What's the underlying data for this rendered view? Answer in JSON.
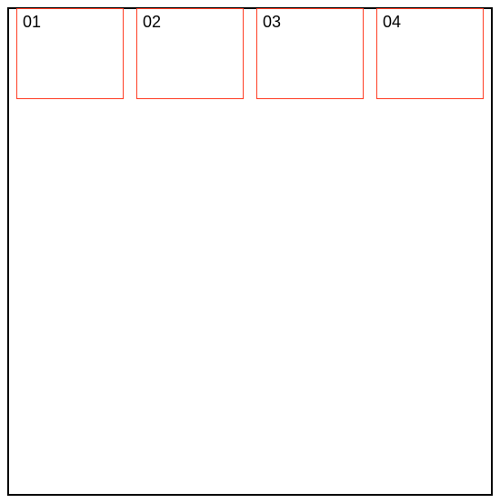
{
  "container": {
    "border_color": "#000000",
    "background": "#ffffff"
  },
  "tile_style": {
    "border_color": "#ff3e25",
    "background": "#ffffff"
  },
  "tiles": [
    {
      "label": "01"
    },
    {
      "label": "02"
    },
    {
      "label": "03"
    },
    {
      "label": "04"
    }
  ]
}
